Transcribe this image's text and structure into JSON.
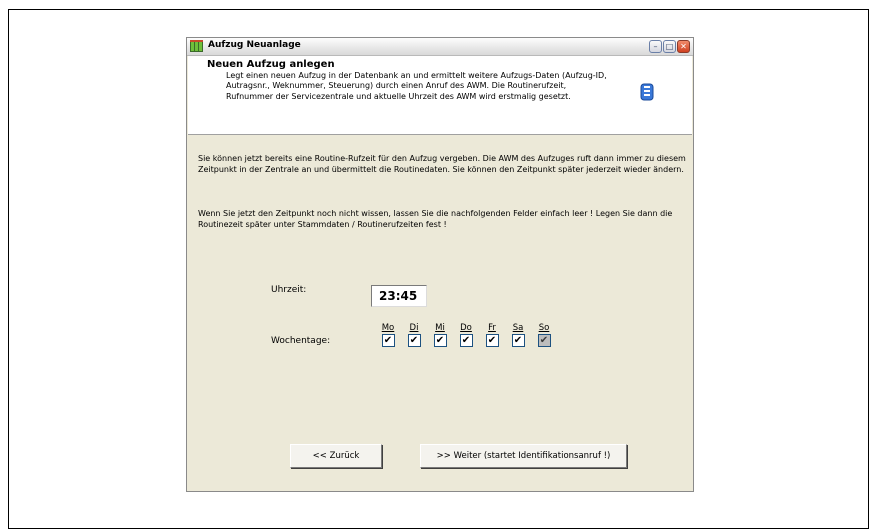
{
  "window": {
    "title": "Aufzug Neuanlage"
  },
  "header": {
    "title": "Neuen Aufzug anlegen",
    "description": "Legt einen neuen Aufzug in der Datenbank an und ermittelt  weitere Aufzugs-Daten (Aufzug-ID, Autragsnr., Weknummer, Steuerung) durch einen Anruf des AWM. Die Routinerufzeit, Rufnummer der Servicezentrale und aktuelle Uhrzeit des AWM wird erstmalig gesetzt."
  },
  "body": {
    "paragraph1": "Sie können jetzt bereits eine Routine-Rufzeit für den Aufzug vergeben. Die AWM des Aufzuges ruft dann immer zu diesem Zeitpunkt in der Zentrale an und übermittelt die Routinedaten.  Sie können den Zeitpunkt später jederzeit wieder ändern.",
    "paragraph2": "Wenn Sie jetzt den Zeitpunkt noch nicht wissen, lassen Sie die nachfolgenden Felder einfach leer ! Legen Sie dann die Routinezeit später unter Stammdaten / Routinerufzeiten fest !"
  },
  "form": {
    "time_label": "Uhrzeit:",
    "time_value": "23:45",
    "weekdays_label": "Wochentage:",
    "days": [
      {
        "label": "Mo",
        "checked": true
      },
      {
        "label": "Di",
        "checked": true
      },
      {
        "label": "Mi",
        "checked": true
      },
      {
        "label": "Do",
        "checked": true
      },
      {
        "label": "Fr",
        "checked": true
      },
      {
        "label": "Sa",
        "checked": true
      },
      {
        "label": "So",
        "checked": true
      }
    ]
  },
  "buttons": {
    "back": "<<  Zurück",
    "next": ">>   Weiter (startet Identifikationsanruf !)"
  }
}
